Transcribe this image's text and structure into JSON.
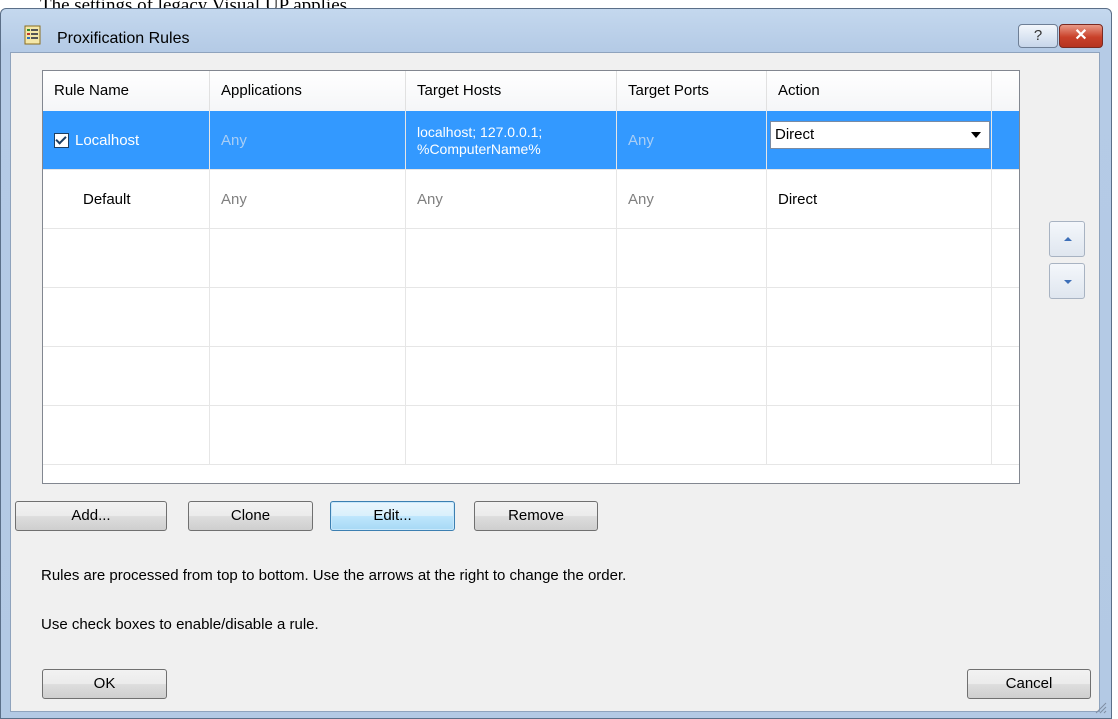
{
  "top_caption": "The settings of legacy Visual UP applies.",
  "window": {
    "title": "Proxification Rules",
    "help_label": "?",
    "close_label": "✕"
  },
  "table": {
    "columns": [
      "Rule Name",
      "Applications",
      "Target Hosts",
      "Target Ports",
      "Action"
    ],
    "rows": [
      {
        "enabled": true,
        "name": "Localhost",
        "applications": "Any",
        "target_hosts_line1": "localhost; 127.0.0.1;",
        "target_hosts_line2": "%ComputerName%",
        "target_ports": "Any",
        "action": "Direct",
        "selected": true
      },
      {
        "name": "Default",
        "applications": "Any",
        "target_hosts": "Any",
        "target_ports": "Any",
        "action": "Direct",
        "selected": false
      }
    ]
  },
  "buttons": {
    "add": "Add...",
    "clone": "Clone",
    "edit": "Edit...",
    "remove": "Remove",
    "ok": "OK",
    "cancel": "Cancel"
  },
  "info": {
    "line1": "Rules are processed from top to bottom. Use the arrows at the right to change the order.",
    "line2": "Use check boxes to enable/disable a rule."
  },
  "icons": {
    "app": "rules-list-icon",
    "move_up": "arrow-up-icon",
    "move_down": "arrow-down-icon"
  },
  "colors": {
    "selection": "#3399ff",
    "frame": "#b5cbe6",
    "close": "#c9412a"
  }
}
